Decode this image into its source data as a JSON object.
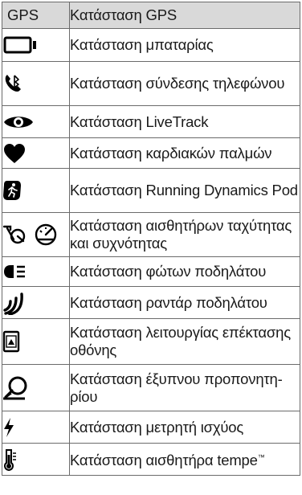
{
  "header": {
    "col1": "GPS",
    "col2": "Κατάσταση GPS"
  },
  "rows": [
    {
      "icon": "battery-icon",
      "label": "Κατάσταση μπαταρίας"
    },
    {
      "icon": "bluetooth-phone-icon",
      "label": "Κατάσταση σύνδεσης τηλεφώνου"
    },
    {
      "icon": "eye-icon",
      "label": "Κατάσταση LiveTrack"
    },
    {
      "icon": "heart-icon",
      "label": "Κατάσταση καρδιακών παλμών"
    },
    {
      "icon": "running-dynamics-pod-icon",
      "label": "Κατάσταση Running Dynamics Pod"
    },
    {
      "icon": "speed-cadence-sensor-icon",
      "label": "Κατάσταση αισθητήρων ταχύτητας και συχνότητας"
    },
    {
      "icon": "bike-light-icon",
      "label": "Κατάσταση φώτων ποδηλάτου"
    },
    {
      "icon": "bike-radar-icon",
      "label": "Κατάσταση ραντάρ ποδηλάτου"
    },
    {
      "icon": "extended-display-icon",
      "label": "Κατάσταση λειτουργίας επέκτασης οθόνης"
    },
    {
      "icon": "smart-trainer-icon",
      "label": "Κατάσταση έξυπνου προπονητη-ρίου"
    },
    {
      "icon": "power-meter-icon",
      "label": "Κατάσταση μετρητή ισχύος"
    },
    {
      "icon": "tempe-sensor-icon",
      "label": "Κατάσταση αισθητήρα tempe",
      "suffix": "™"
    }
  ]
}
